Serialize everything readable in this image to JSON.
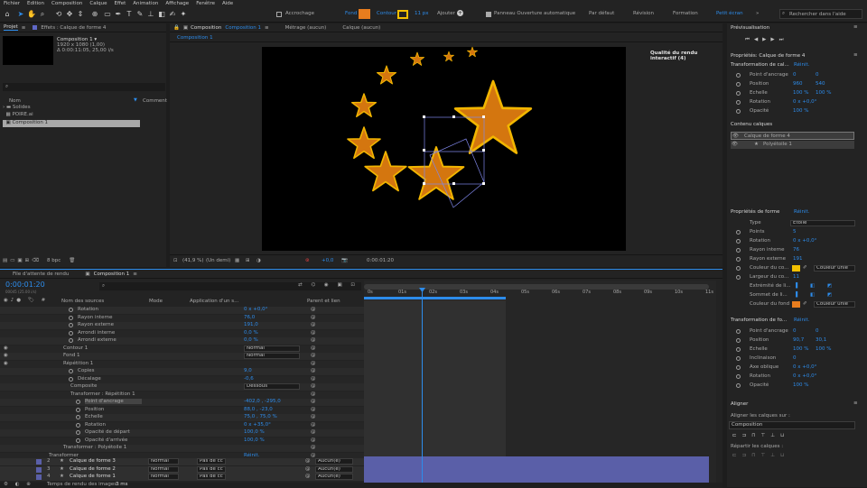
{
  "menu": [
    "Fichier",
    "Edition",
    "Composition",
    "Calque",
    "Effet",
    "Animation",
    "Affichage",
    "Fenêtre",
    "Aide"
  ],
  "toolbar": {
    "snap": "Accrochage",
    "fill": "Fond",
    "stroke": "Contour",
    "stroke_px": "11 px",
    "add": "Ajouter :",
    "rotobezier": "Panneau Ouverture automatique",
    "workspaces": [
      "Par défaut",
      "Révision",
      "Formation",
      "Petit écran"
    ],
    "active_workspace": "Petit écran",
    "search": "Rechercher dans l'aide"
  },
  "colors": {
    "accent": "#2d8ceb",
    "fill": "#e87d1e",
    "stroke": "#f2c000"
  },
  "project": {
    "tab": "Projet",
    "effects_tab": "Effets : Calque de forme 4",
    "comp_name": "Composition 1 ▾",
    "comp_info": [
      "1920 x 1080 (1,00)",
      "Δ 0:00:11:05, 25,00 i/s"
    ],
    "col_name": "Nom",
    "col_comment": "Comment",
    "items": [
      "Solides",
      "POIRE.ai",
      "Composition 1"
    ],
    "bpc": "8 bpc"
  },
  "viewer": {
    "tab": "Composition",
    "comp_tab_name": "Composition 1",
    "sub_tabs": [
      "Métrage (aucun)",
      "Calque (aucun)"
    ],
    "breadcrumb": "Composition 1",
    "quality_msg": "Qualité du rendu interactif (4)",
    "zoom": "(41,9 %)",
    "res": "(Un demi)",
    "exposure": "+0,0",
    "timecode": "0:00:01:20"
  },
  "timeline": {
    "tabs": [
      "File d'attente de rendu",
      "Composition 1"
    ],
    "timecode": "0:00:01:20",
    "fps_sub": "00045 (25.00 i/s)",
    "headers": {
      "name": "Nom des sources",
      "mode": "Mode",
      "app": "Application d'un s...",
      "parent": "Parent et lien"
    },
    "ruler": [
      "0s",
      "01s",
      "02s",
      "03s",
      "04s",
      "05s",
      "06s",
      "07s",
      "08s",
      "09s",
      "10s",
      "11s"
    ],
    "rows": [
      {
        "n": "Rotation",
        "v": "0 x +0,0°"
      },
      {
        "n": "Rayon interne",
        "v": "76,0"
      },
      {
        "n": "Rayon externe",
        "v": "191,0"
      },
      {
        "n": "Arrondi interne",
        "v": "0,0 %"
      },
      {
        "n": "Arrondi externe",
        "v": "0,0 %"
      },
      {
        "n": "Contour 1",
        "v": "Normal"
      },
      {
        "n": "Fond 1",
        "v": "Normal"
      },
      {
        "n": "Répétition 1",
        "v": ""
      },
      {
        "n": "Copies",
        "v": "9,0"
      },
      {
        "n": "Décalage",
        "v": "-0,6"
      },
      {
        "n": "Composite",
        "v": "Dessous"
      },
      {
        "n": "Transformer : Répétition 1",
        "v": ""
      },
      {
        "n": "Point d'ancrage",
        "v": "-402,0 , -295,0"
      },
      {
        "n": "Position",
        "v": "88,0 , -23,0"
      },
      {
        "n": "Echelle",
        "v": "75,0 , 75,0 %"
      },
      {
        "n": "Rotation",
        "v": "0 x +35,0°"
      },
      {
        "n": "Opacité de départ",
        "v": "100,0 %"
      },
      {
        "n": "Opacité d'arrivée",
        "v": "100,0 %"
      },
      {
        "n": "Transformer : Polyétoile 1",
        "v": ""
      },
      {
        "n": "Transformer",
        "v": "Réinit."
      }
    ],
    "layers": [
      {
        "num": "2",
        "name": "Calque de forme 3",
        "mode": "Normal",
        "trk": "Pas de cc",
        "parent": "Aucun(e)"
      },
      {
        "num": "3",
        "name": "Calque de forme 2",
        "mode": "Normal",
        "trk": "Pas de cc",
        "parent": "Aucun(e)"
      },
      {
        "num": "4",
        "name": "Calque de forme 1",
        "mode": "Normal",
        "trk": "Pas de cc",
        "parent": "Aucun(e)"
      }
    ],
    "footer": "Temps de rendu des images :",
    "footer_val": "3 ms"
  },
  "right": {
    "preview_title": "Prévisualisation",
    "props_title": "Propriétés: Calque de forme 4",
    "transform_title": "Transformation de cal...",
    "reset": "Réinit.",
    "transform": [
      {
        "n": "Point d'ancrage",
        "a": "0",
        "b": "0"
      },
      {
        "n": "Position",
        "a": "960",
        "b": "540"
      },
      {
        "n": "Echelle",
        "a": "100 %",
        "b": "100 %"
      },
      {
        "n": "Rotation",
        "a": "0 x +0,0°",
        "b": ""
      },
      {
        "n": "Opacité",
        "a": "100 %",
        "b": ""
      }
    ],
    "contents_title": "Contenu calques",
    "contents": [
      "Calque de forme 4",
      "Polyétoile 1"
    ],
    "shape_title": "Propriétés de forme",
    "shape": [
      {
        "n": "Type",
        "v": "Etoile"
      },
      {
        "n": "Points",
        "v": "5"
      },
      {
        "n": "Rotation",
        "v": "0 x +0,0°"
      },
      {
        "n": "Rayon interne",
        "v": "76"
      },
      {
        "n": "Rayon externe",
        "v": "191"
      },
      {
        "n": "Couleur du co...",
        "v": "Couleur unie"
      },
      {
        "n": "Largeur du co...",
        "v": "11"
      },
      {
        "n": "Extrémité de li...",
        "v": ""
      },
      {
        "n": "Sommet de li...",
        "v": ""
      },
      {
        "n": "Couleur du fond",
        "v": "Couleur unie"
      }
    ],
    "shape_transform_title": "Transformation de fo...",
    "shape_transform": [
      {
        "n": "Point d'ancrage",
        "a": "0",
        "b": "0"
      },
      {
        "n": "Position",
        "a": "90,7",
        "b": "30,1"
      },
      {
        "n": "Echelle",
        "a": "100 %",
        "b": "100 %"
      },
      {
        "n": "Inclinaison",
        "a": "0",
        "b": ""
      },
      {
        "n": "Axe oblique",
        "a": "0 x +0,0°",
        "b": ""
      },
      {
        "n": "Rotation",
        "a": "0 x +0,0°",
        "b": ""
      },
      {
        "n": "Opacité",
        "a": "100 %",
        "b": ""
      }
    ],
    "align_title": "Aligner",
    "align_to_label": "Aligner les calques sur :",
    "align_to": "Composition",
    "distribute": "Répartir les calques :"
  }
}
